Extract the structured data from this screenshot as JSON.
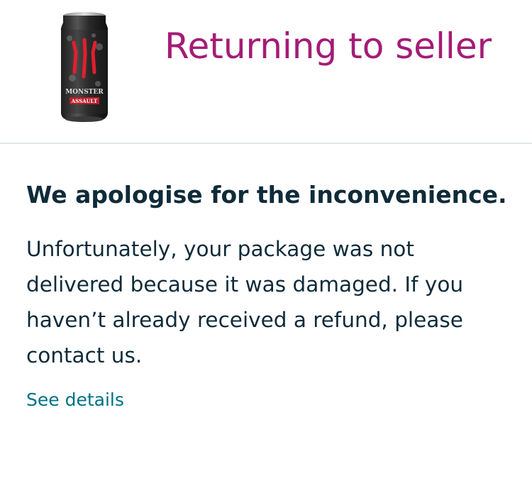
{
  "header": {
    "product_image": {
      "icon": "monster-energy-can-image",
      "brand_text": "MONSTER",
      "variant_text": "ASSAULT"
    },
    "status_title": "Returning to seller",
    "status_color": "#a41c76"
  },
  "content": {
    "heading": "We apologise for the inconvenience.",
    "message": "Unfortunately, your package was not delivered because it was damaged. If you haven’t already received a refund, please contact us.",
    "link_label": "See details",
    "link_color": "#007185"
  }
}
